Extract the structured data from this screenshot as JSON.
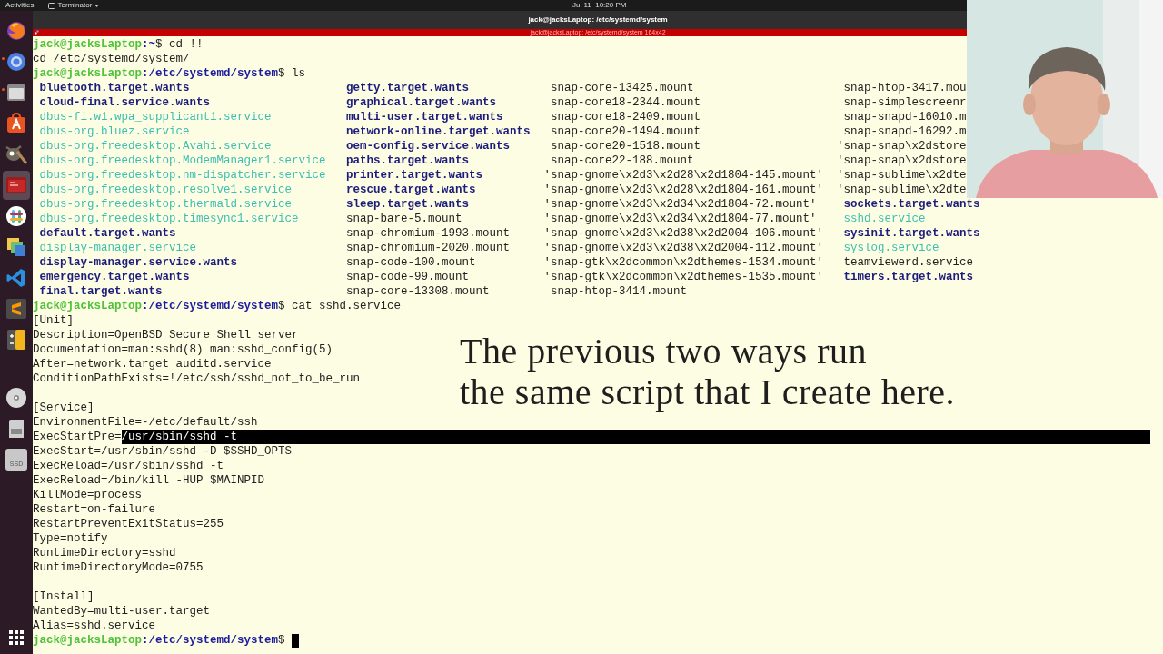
{
  "top_bar": {
    "activities": "Activities",
    "app_menu": "Terminator",
    "clock": "Jul 11  10:20 PM"
  },
  "dock": {
    "apps": [
      {
        "kind": "fox-browser",
        "running": false,
        "selected": false
      },
      {
        "kind": "browser",
        "running": true,
        "selected": false
      },
      {
        "kind": "files",
        "running": true,
        "selected": false
      },
      {
        "kind": "store",
        "running": false,
        "selected": false
      },
      {
        "kind": "image-editor",
        "running": false,
        "selected": false
      },
      {
        "kind": "terminal",
        "running": false,
        "selected": true
      },
      {
        "kind": "chat",
        "running": false,
        "selected": false
      },
      {
        "kind": "stack",
        "running": false,
        "selected": false
      },
      {
        "kind": "code-editor",
        "running": false,
        "selected": false
      },
      {
        "kind": "text-editor",
        "running": false,
        "selected": false
      },
      {
        "kind": "calculator",
        "running": false,
        "selected": false
      }
    ],
    "devices": [
      {
        "kind": "disc"
      },
      {
        "kind": "sd-card"
      },
      {
        "kind": "ssd",
        "label": "SSD"
      }
    ]
  },
  "window": {
    "title": "jack@jacksLaptop: /etc/systemd/system",
    "terminal_title": "jack@jacksLaptop: /etc/systemd/system 164x42"
  },
  "terminal": {
    "lines": [
      {
        "kind": "prompt",
        "user": "jack@jacksLaptop",
        "path": ":~",
        "sign": "$",
        "command": "cd !!",
        "cursor": false
      },
      {
        "kind": "output",
        "text": "cd /etc/systemd/system/"
      },
      {
        "kind": "prompt",
        "user": "jack@jacksLaptop",
        "path": ":/etc/systemd/system",
        "sign": "$",
        "command": "ls",
        "cursor": false
      },
      {
        "kind": "ls",
        "columns": [
          {
            "items": [
              {
                "name": "bluetooth.target.wants",
                "kind": "dir"
              },
              {
                "name": "cloud-final.service.wants",
                "kind": "dir"
              },
              {
                "name": "dbus-fi.w1.wpa_supplicant1.service",
                "kind": "service"
              },
              {
                "name": "dbus-org.bluez.service",
                "kind": "service"
              },
              {
                "name": "dbus-org.freedesktop.Avahi.service",
                "kind": "service"
              },
              {
                "name": "dbus-org.freedesktop.ModemManager1.service",
                "kind": "service"
              },
              {
                "name": "dbus-org.freedesktop.nm-dispatcher.service",
                "kind": "service"
              },
              {
                "name": "dbus-org.freedesktop.resolve1.service",
                "kind": "service"
              },
              {
                "name": "dbus-org.freedesktop.thermald.service",
                "kind": "service"
              },
              {
                "name": "dbus-org.freedesktop.timesync1.service",
                "kind": "service"
              },
              {
                "name": "default.target.wants",
                "kind": "dir"
              },
              {
                "name": "display-manager.service",
                "kind": "service"
              },
              {
                "name": "display-manager.service.wants",
                "kind": "dir"
              },
              {
                "name": "emergency.target.wants",
                "kind": "dir"
              },
              {
                "name": "final.target.wants",
                "kind": "dir"
              }
            ]
          },
          {
            "items": [
              {
                "name": "getty.target.wants",
                "kind": "dir"
              },
              {
                "name": "graphical.target.wants",
                "kind": "dir"
              },
              {
                "name": "multi-user.target.wants",
                "kind": "dir"
              },
              {
                "name": "network-online.target.wants",
                "kind": "dir"
              },
              {
                "name": "oem-config.service.wants",
                "kind": "dir"
              },
              {
                "name": "paths.target.wants",
                "kind": "dir"
              },
              {
                "name": "printer.target.wants",
                "kind": "dir"
              },
              {
                "name": "rescue.target.wants",
                "kind": "dir"
              },
              {
                "name": "sleep.target.wants",
                "kind": "dir"
              },
              {
                "name": "snap-bare-5.mount",
                "kind": "file"
              },
              {
                "name": "snap-chromium-1993.mount",
                "kind": "file"
              },
              {
                "name": "snap-chromium-2020.mount",
                "kind": "file"
              },
              {
                "name": "snap-code-100.mount",
                "kind": "file"
              },
              {
                "name": "snap-code-99.mount",
                "kind": "file"
              },
              {
                "name": "snap-core-13308.mount",
                "kind": "file"
              }
            ]
          },
          {
            "items": [
              {
                "name": "snap-core-13425.mount",
                "kind": "file",
                "quoted": false
              },
              {
                "name": "snap-core18-2344.mount",
                "kind": "file",
                "quoted": false
              },
              {
                "name": "snap-core18-2409.mount",
                "kind": "file",
                "quoted": false
              },
              {
                "name": "snap-core20-1494.mount",
                "kind": "file",
                "quoted": false
              },
              {
                "name": "snap-core20-1518.mount",
                "kind": "file",
                "quoted": false
              },
              {
                "name": "snap-core22-188.mount",
                "kind": "file",
                "quoted": false
              },
              {
                "name": "'snap-gnome\\x2d3\\x2d28\\x2d1804-145.mount'",
                "kind": "file",
                "quoted": true
              },
              {
                "name": "'snap-gnome\\x2d3\\x2d28\\x2d1804-161.mount'",
                "kind": "file",
                "quoted": true
              },
              {
                "name": "'snap-gnome\\x2d3\\x2d34\\x2d1804-72.mount'",
                "kind": "file",
                "quoted": true
              },
              {
                "name": "'snap-gnome\\x2d3\\x2d34\\x2d1804-77.mount'",
                "kind": "file",
                "quoted": true
              },
              {
                "name": "'snap-gnome\\x2d3\\x2d38\\x2d2004-106.mount'",
                "kind": "file",
                "quoted": true
              },
              {
                "name": "'snap-gnome\\x2d3\\x2d38\\x2d2004-112.mount'",
                "kind": "file",
                "quoted": true
              },
              {
                "name": "'snap-gtk\\x2dcommon\\x2dthemes-1534.mount'",
                "kind": "file",
                "quoted": true
              },
              {
                "name": "'snap-gtk\\x2dcommon\\x2dthemes-1535.mount'",
                "kind": "file",
                "quoted": true
              },
              {
                "name": "snap-htop-3414.mount",
                "kind": "file",
                "quoted": false
              }
            ]
          },
          {
            "items": [
              {
                "name": "snap-htop-3417.mou",
                "kind": "file",
                "quoted": false
              },
              {
                "name": "snap-simplescreenr",
                "kind": "file",
                "quoted": false
              },
              {
                "name": "snap-snapd-16010.m",
                "kind": "file",
                "quoted": false
              },
              {
                "name": "snap-snapd-16292.m",
                "kind": "file",
                "quoted": false
              },
              {
                "name": "'snap-snap\\x2dstore",
                "kind": "file",
                "quoted": true
              },
              {
                "name": "'snap-snap\\x2dstore",
                "kind": "file",
                "quoted": true
              },
              {
                "name": "'snap-sublime\\x2dte",
                "kind": "file",
                "quoted": true
              },
              {
                "name": "'snap-sublime\\x2dte",
                "kind": "file",
                "quoted": true
              },
              {
                "name": "sockets.target.wants",
                "kind": "dir",
                "quoted": false
              },
              {
                "name": "sshd.service",
                "kind": "service",
                "quoted": false
              },
              {
                "name": "sysinit.target.wants",
                "kind": "dir",
                "quoted": false
              },
              {
                "name": "syslog.service",
                "kind": "service",
                "quoted": false
              },
              {
                "name": "teamviewerd.service",
                "kind": "file",
                "quoted": false
              },
              {
                "name": "timers.target.wants",
                "kind": "dir",
                "quoted": false
              }
            ]
          }
        ]
      },
      {
        "kind": "prompt",
        "user": "jack@jacksLaptop",
        "path": ":/etc/systemd/system",
        "sign": "$",
        "command": "cat sshd.service",
        "cursor": false
      },
      {
        "kind": "output",
        "text": "[Unit]"
      },
      {
        "kind": "output",
        "text": "Description=OpenBSD Secure Shell server"
      },
      {
        "kind": "output",
        "text": "Documentation=man:sshd(8) man:sshd_config(5)"
      },
      {
        "kind": "output",
        "text": "After=network.target auditd.service"
      },
      {
        "kind": "output",
        "text": "ConditionPathExists=!/etc/ssh/sshd_not_to_be_run"
      },
      {
        "kind": "blank"
      },
      {
        "kind": "output",
        "text": "[Service]"
      },
      {
        "kind": "output",
        "text": "EnvironmentFile=-/etc/default/ssh"
      },
      {
        "kind": "selection",
        "text": "ExecStartPre=",
        "selected_text": "/usr/sbin/sshd -t"
      },
      {
        "kind": "output",
        "text": "ExecStart=/usr/sbin/sshd -D $SSHD_OPTS"
      },
      {
        "kind": "output",
        "text": "ExecReload=/usr/sbin/sshd -t"
      },
      {
        "kind": "output",
        "text": "ExecReload=/bin/kill -HUP $MAINPID"
      },
      {
        "kind": "output",
        "text": "KillMode=process"
      },
      {
        "kind": "output",
        "text": "Restart=on-failure"
      },
      {
        "kind": "output",
        "text": "RestartPreventExitStatus=255"
      },
      {
        "kind": "output",
        "text": "Type=notify"
      },
      {
        "kind": "output",
        "text": "RuntimeDirectory=sshd"
      },
      {
        "kind": "output",
        "text": "RuntimeDirectoryMode=0755"
      },
      {
        "kind": "blank"
      },
      {
        "kind": "output",
        "text": "[Install]"
      },
      {
        "kind": "output",
        "text": "WantedBy=multi-user.target"
      },
      {
        "kind": "output",
        "text": "Alias=sshd.service"
      },
      {
        "kind": "prompt",
        "user": "jack@jacksLaptop",
        "path": ":/etc/systemd/system",
        "sign": "$",
        "cursor": true
      }
    ]
  },
  "caption": {
    "lines": [
      "The previous two ways run",
      "the same script that I create here."
    ]
  }
}
